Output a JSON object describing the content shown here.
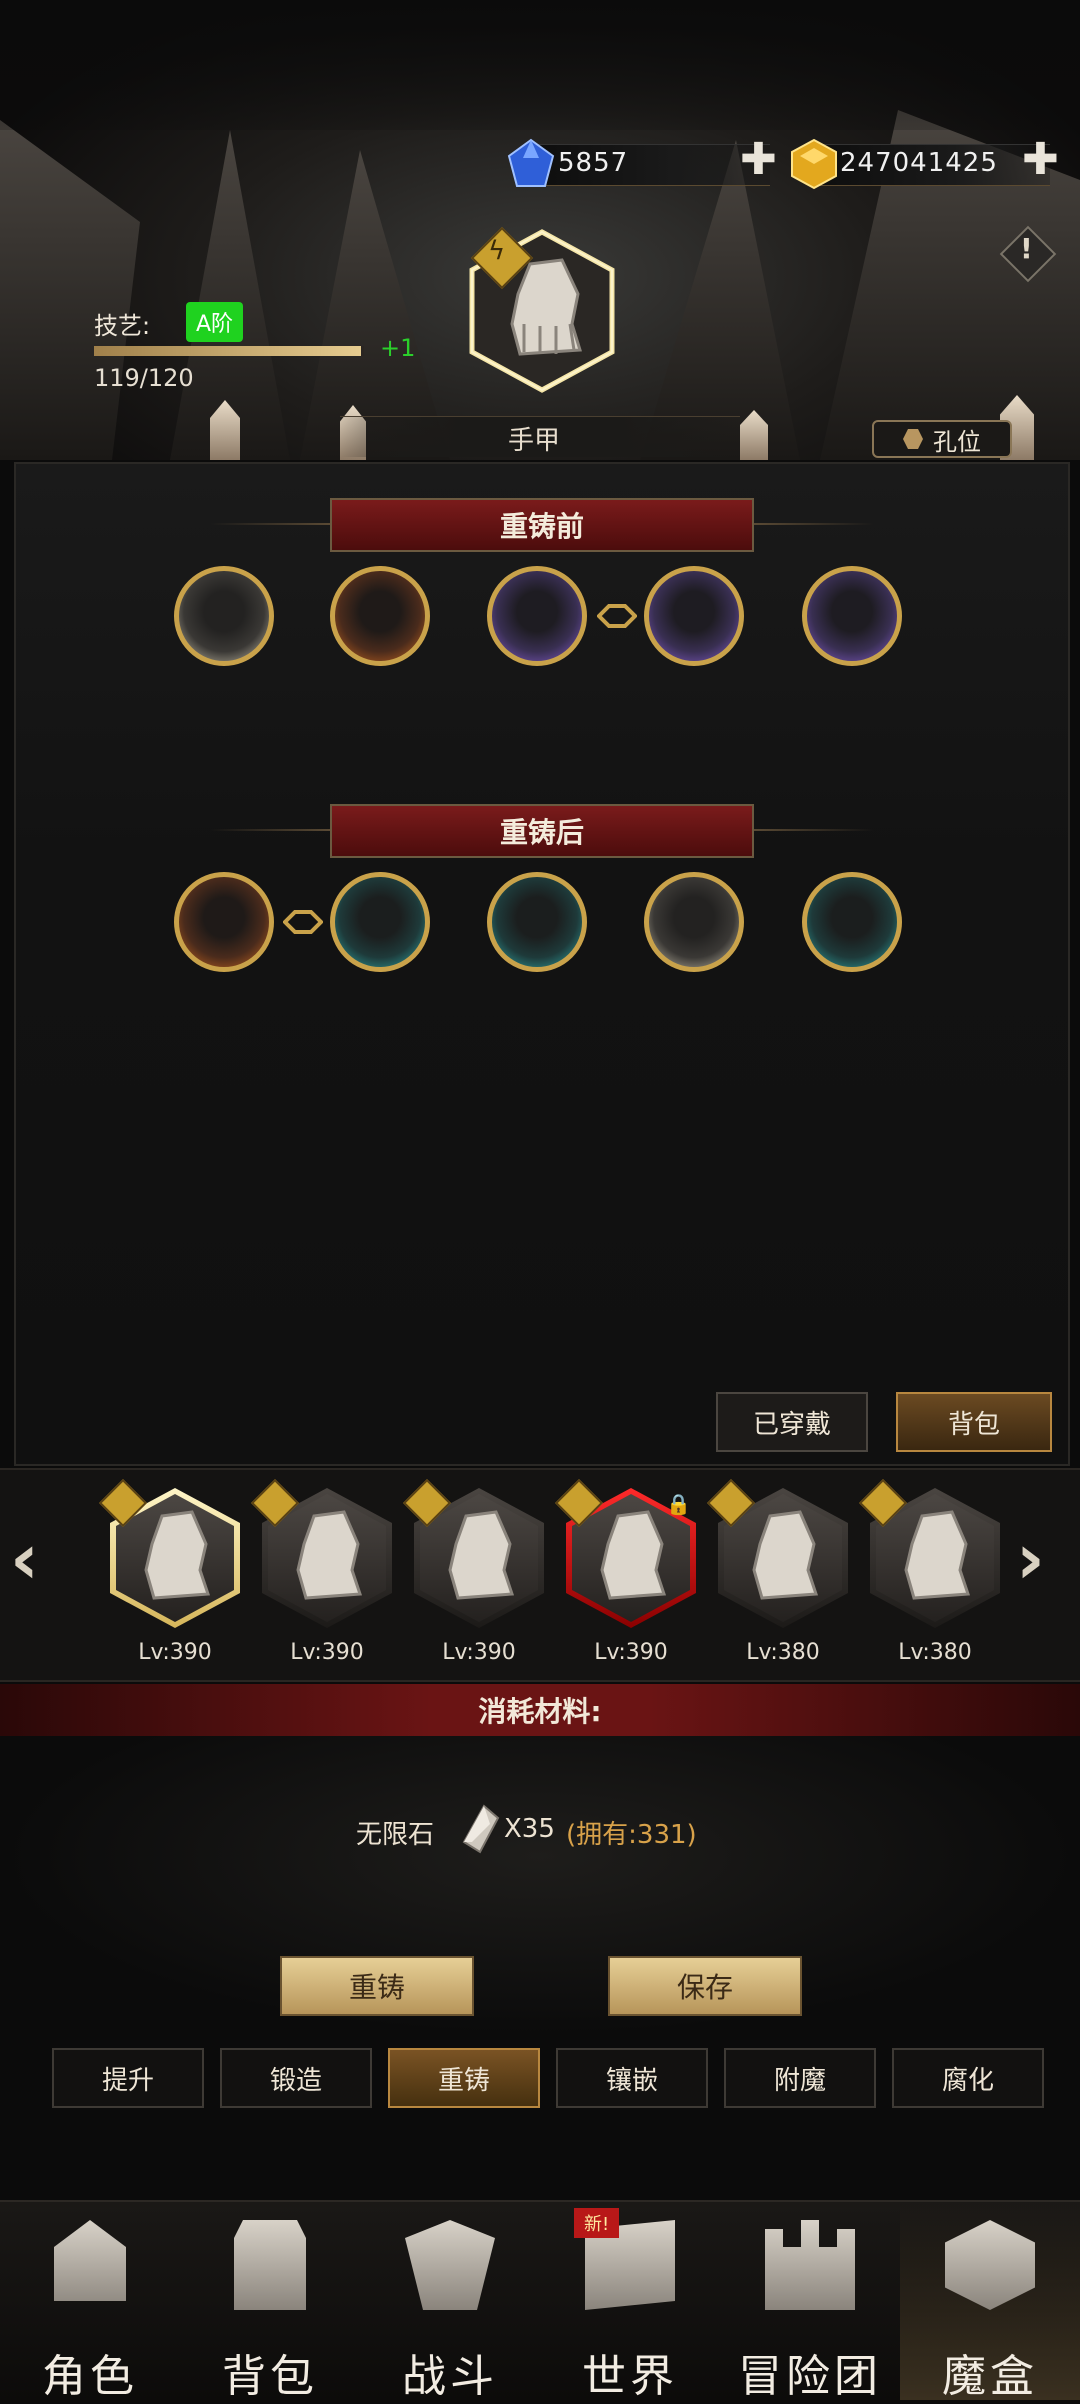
{
  "currency": {
    "gems": "5857",
    "gold": "247041425"
  },
  "skill": {
    "label": "技艺:",
    "grade": "A阶",
    "progress_text": "119/120",
    "progress_fraction": 0.99,
    "increment": "+1"
  },
  "equipment": {
    "name": "手甲"
  },
  "socket_button": "孔位",
  "before_title": "重铸前",
  "after_title": "重铸后",
  "before_slots": [
    "white",
    "orange",
    "purple",
    "purple",
    "purple"
  ],
  "after_slots": [
    "orange",
    "teal",
    "teal",
    "white",
    "teal"
  ],
  "list_tabs": {
    "equipped": "已穿戴",
    "bag": "背包"
  },
  "carousel": [
    {
      "level": "Lv:390",
      "state": "selected"
    },
    {
      "level": "Lv:390",
      "state": "normal"
    },
    {
      "level": "Lv:390",
      "state": "normal"
    },
    {
      "level": "Lv:390",
      "state": "locked"
    },
    {
      "level": "Lv:380",
      "state": "normal"
    },
    {
      "level": "Lv:380",
      "state": "normal"
    }
  ],
  "consumption": {
    "title": "消耗材料:",
    "material_name": "无限石",
    "quantity": "X35",
    "owned": "(拥有:331)"
  },
  "actions": {
    "reforge": "重铸",
    "save": "保存"
  },
  "sub_tabs": [
    "提升",
    "锻造",
    "重铸",
    "镶嵌",
    "附魔",
    "腐化"
  ],
  "active_sub_tab": 2,
  "nav": [
    {
      "label": "角色",
      "icon": "helmet-icon"
    },
    {
      "label": "背包",
      "icon": "backpack-icon"
    },
    {
      "label": "战斗",
      "icon": "shield-sword-icon"
    },
    {
      "label": "世界",
      "icon": "scroll-map-icon",
      "badge": "新!"
    },
    {
      "label": "冒险团",
      "icon": "castle-icon"
    },
    {
      "label": "魔盒",
      "icon": "magic-cube-icon"
    }
  ],
  "active_nav": 5,
  "colors": {
    "grade_green": "#1fd21f",
    "accent_gold": "#c9a24a",
    "banner_red": "#7a1b1b",
    "locked_red": "#ff2a2a"
  }
}
